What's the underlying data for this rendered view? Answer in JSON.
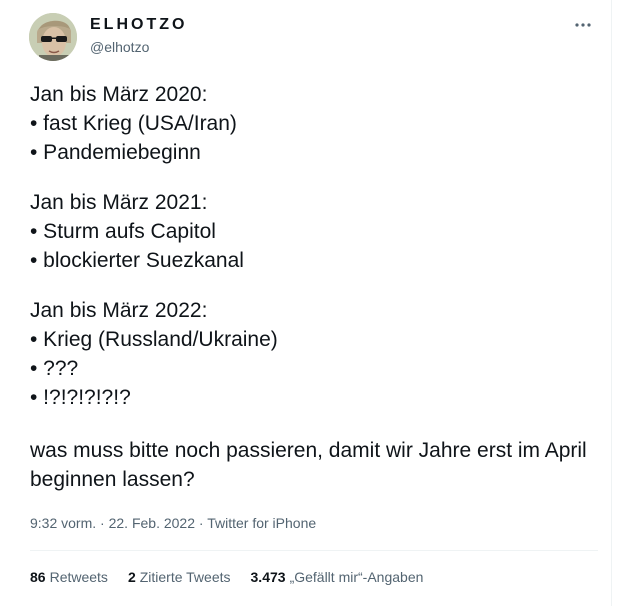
{
  "author": {
    "display_name": "ELHOTZO",
    "handle": "@elhotzo",
    "avatar": "profile-photo"
  },
  "more_icon": "more-horizontal-icon",
  "tweet": {
    "lines_2020": [
      "Jan bis März 2020:",
      "• fast Krieg (USA/Iran)",
      "• Pandemiebeginn"
    ],
    "lines_2021": [
      "Jan bis März 2021:",
      "• Sturm aufs Capitol",
      "• blockierter Suezkanal"
    ],
    "lines_2022": [
      "Jan bis März 2022:",
      "• Krieg (Russland/Ukraine)",
      "• ???",
      "• !?!?!?!?!?"
    ],
    "closing": "was muss bitte noch passieren, damit wir Jahre erst im April beginnen lassen?"
  },
  "meta": {
    "time": "9:32 vorm.",
    "separator": "·",
    "date": "22. Feb. 2022",
    "source": "Twitter for iPhone"
  },
  "stats": {
    "retweets_count": "86",
    "retweets_label": "Retweets",
    "quotes_count": "2",
    "quotes_label": "Zitierte Tweets",
    "likes_count": "3.473",
    "likes_label": "„Gefällt mir“-Angaben"
  },
  "colors": {
    "text": "#0f1419",
    "secondary": "#536471",
    "divider": "#eff3f4"
  }
}
